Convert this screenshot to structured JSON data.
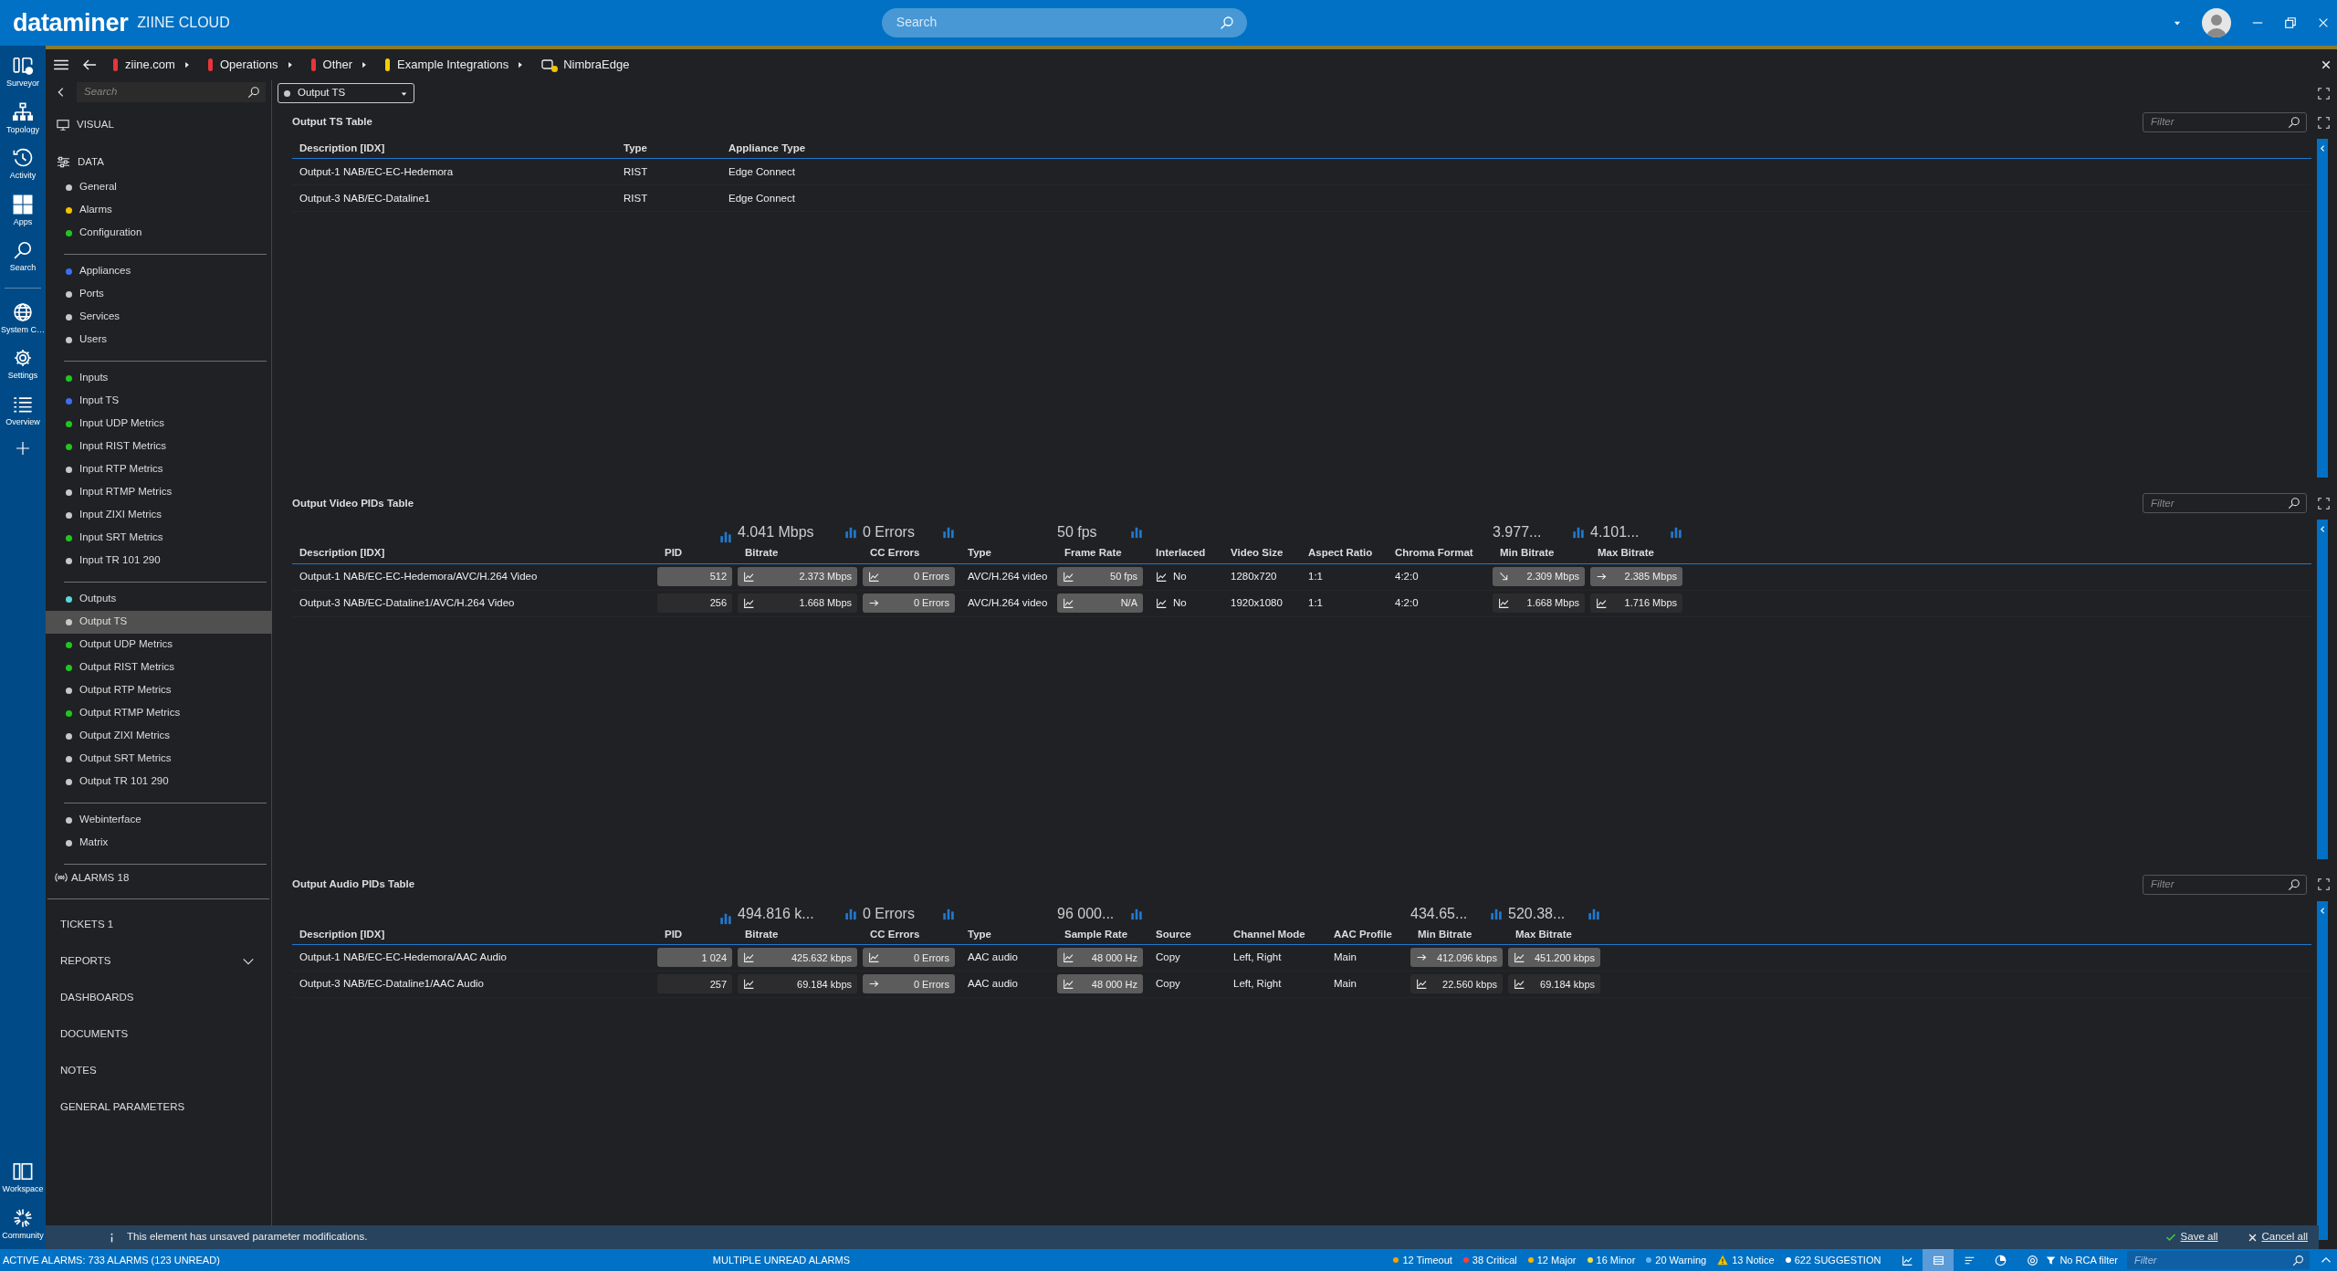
{
  "app": {
    "brand": "dataminer",
    "system": "ZIINE CLOUD",
    "search": {
      "placeholder": "Search"
    }
  },
  "rail": {
    "top": [
      "Surveyor",
      "Topology",
      "Activity",
      "Apps",
      "Search"
    ],
    "middle": [
      "System C…",
      "Settings",
      "Overview"
    ],
    "bottom": [
      "Workspace",
      "Community"
    ]
  },
  "breadcrumb": [
    {
      "label": "ziine.com",
      "kind": "view",
      "color": "#e8343c"
    },
    {
      "label": "Operations",
      "kind": "view",
      "color": "#e8343c"
    },
    {
      "label": "Other",
      "kind": "view",
      "color": "#e8343c"
    },
    {
      "label": "Example Integrations",
      "kind": "view",
      "color": "#f2d000"
    },
    {
      "label": "NimbraEdge",
      "kind": "element",
      "color": "#f2c200"
    }
  ],
  "sidebar": {
    "search": {
      "placeholder": "Search"
    },
    "visual": "VISUAL",
    "data": "DATA",
    "groups": [
      {
        "items": [
          {
            "label": "General",
            "color": "#c8c8c8",
            "selected": false
          },
          {
            "label": "Alarms",
            "color": "#f2c200",
            "selected": false
          },
          {
            "label": "Configuration",
            "color": "#1ec71e",
            "selected": false
          }
        ]
      },
      {
        "items": [
          {
            "label": "Appliances",
            "color": "#3a6ff0",
            "selected": false
          },
          {
            "label": "Ports",
            "color": "#c8c8c8",
            "selected": false
          },
          {
            "label": "Services",
            "color": "#c8c8c8",
            "selected": false
          },
          {
            "label": "Users",
            "color": "#c8c8c8",
            "selected": false
          }
        ]
      },
      {
        "items": [
          {
            "label": "Inputs",
            "color": "#1ec71e",
            "selected": false
          },
          {
            "label": "Input TS",
            "color": "#3a6ff0",
            "selected": false
          },
          {
            "label": "Input UDP Metrics",
            "color": "#1ec71e",
            "selected": false
          },
          {
            "label": "Input RIST Metrics",
            "color": "#1ec71e",
            "selected": false
          },
          {
            "label": "Input RTP Metrics",
            "color": "#c8c8c8",
            "selected": false
          },
          {
            "label": "Input RTMP Metrics",
            "color": "#c8c8c8",
            "selected": false
          },
          {
            "label": "Input ZIXI Metrics",
            "color": "#c8c8c8",
            "selected": false
          },
          {
            "label": "Input SRT Metrics",
            "color": "#1ec71e",
            "selected": false
          },
          {
            "label": "Input TR 101 290",
            "color": "#c8c8c8",
            "selected": false
          }
        ]
      },
      {
        "items": [
          {
            "label": "Outputs",
            "color": "#5cd6dc",
            "selected": false
          },
          {
            "label": "Output TS",
            "color": "#c8c8c8",
            "selected": true
          },
          {
            "label": "Output UDP Metrics",
            "color": "#1ec71e",
            "selected": false
          },
          {
            "label": "Output RIST Metrics",
            "color": "#1ec71e",
            "selected": false
          },
          {
            "label": "Output RTP Metrics",
            "color": "#c8c8c8",
            "selected": false
          },
          {
            "label": "Output RTMP Metrics",
            "color": "#1ec71e",
            "selected": false
          },
          {
            "label": "Output ZIXI Metrics",
            "color": "#c8c8c8",
            "selected": false
          },
          {
            "label": "Output SRT Metrics",
            "color": "#c8c8c8",
            "selected": false
          },
          {
            "label": "Output TR 101 290",
            "color": "#c8c8c8",
            "selected": false
          }
        ]
      },
      {
        "items": [
          {
            "label": "Webinterface",
            "color": "#c8c8c8",
            "selected": false
          },
          {
            "label": "Matrix",
            "color": "#c8c8c8",
            "selected": false
          }
        ]
      }
    ],
    "alarms": "ALARMS 18",
    "links": [
      {
        "label": "TICKETS 1",
        "has_submenu": false
      },
      {
        "label": "REPORTS",
        "has_submenu": true
      },
      {
        "label": "DASHBOARDS",
        "has_submenu": false
      },
      {
        "label": "DOCUMENTS",
        "has_submenu": false
      },
      {
        "label": "NOTES",
        "has_submenu": false
      },
      {
        "label": "GENERAL PARAMETERS",
        "has_submenu": false
      }
    ]
  },
  "page_selector": {
    "value": "Output TS",
    "color": "#c8c8c8"
  },
  "tables": [
    {
      "title": "Output TS Table",
      "filter": {
        "placeholder": "Filter"
      },
      "columns": [
        {
          "label": "Description [IDX]",
          "kind": "text"
        },
        {
          "label": "Type",
          "kind": "text"
        },
        {
          "label": "Appliance Type",
          "kind": "text"
        }
      ],
      "rows": [
        {
          "cells": [
            "Output-1 NAB/EC-EC-Hedemora",
            "RIST",
            "Edge Connect"
          ]
        },
        {
          "cells": [
            "Output-3 NAB/EC-Dataline1",
            "RIST",
            "Edge Connect"
          ]
        }
      ]
    },
    {
      "title": "Output Video PIDs Table",
      "filter": {
        "placeholder": "Filter"
      },
      "columns": [
        {
          "label": "Description [IDX]",
          "kind": "text"
        },
        {
          "label": "PID",
          "kind": "value",
          "stat": true
        },
        {
          "label": "Bitrate",
          "kind": "value",
          "aggregate": "4.041 Mbps",
          "stat": true
        },
        {
          "label": "CC Errors",
          "kind": "value",
          "aggregate": "0 Errors",
          "stat": true
        },
        {
          "label": "Type",
          "kind": "text"
        },
        {
          "label": "Frame Rate",
          "kind": "value",
          "aggregate": "50 fps",
          "stat": true
        },
        {
          "label": "Interlaced",
          "kind": "trend"
        },
        {
          "label": "Video Size",
          "kind": "text"
        },
        {
          "label": "Aspect Ratio",
          "kind": "text"
        },
        {
          "label": "Chroma Format",
          "kind": "text"
        },
        {
          "label": "Min Bitrate",
          "kind": "value",
          "aggregate": "3.977...",
          "stat": true
        },
        {
          "label": "Max Bitrate",
          "kind": "value",
          "aggregate": "4.101...",
          "stat": true
        }
      ],
      "rows": [
        {
          "cells": [
            "Output-1 NAB/EC-EC-Hedemora/AVC/H.264 Video",
            {
              "text": "512",
              "kind": "plain",
              "highlighted": true
            },
            {
              "text": "2.373 Mbps",
              "kind": "chart",
              "highlighted": true
            },
            {
              "text": "0 Errors",
              "kind": "chart",
              "highlighted": true
            },
            "AVC/H.264 video",
            {
              "text": "50 fps",
              "kind": "chart",
              "highlighted": true
            },
            {
              "text": "No",
              "kind": "chart"
            },
            "1280x720",
            "1:1",
            "4:2:0",
            {
              "text": "2.309 Mbps",
              "kind": "falling",
              "highlighted": true
            },
            {
              "text": "2.385 Mbps",
              "kind": "steady",
              "highlighted": true
            }
          ]
        },
        {
          "cells": [
            "Output-3 NAB/EC-Dataline1/AVC/H.264 Video",
            {
              "text": "256",
              "kind": "plain",
              "highlighted": false
            },
            {
              "text": "1.668 Mbps",
              "kind": "chart",
              "highlighted": false
            },
            {
              "text": "0 Errors",
              "kind": "steady",
              "highlighted": true
            },
            "AVC/H.264 video",
            {
              "text": "N/A",
              "kind": "chart",
              "highlighted": true
            },
            {
              "text": "No",
              "kind": "chart"
            },
            "1920x1080",
            "1:1",
            "4:2:0",
            {
              "text": "1.668 Mbps",
              "kind": "chart",
              "highlighted": false
            },
            {
              "text": "1.716 Mbps",
              "kind": "chart",
              "highlighted": false
            }
          ]
        }
      ]
    },
    {
      "title": "Output Audio PIDs Table",
      "filter": {
        "placeholder": "Filter"
      },
      "columns": [
        {
          "label": "Description [IDX]",
          "kind": "text"
        },
        {
          "label": "PID",
          "kind": "value",
          "stat": true
        },
        {
          "label": "Bitrate",
          "kind": "value",
          "aggregate": "494.816 k...",
          "stat": true
        },
        {
          "label": "CC Errors",
          "kind": "value",
          "aggregate": "0 Errors",
          "stat": true
        },
        {
          "label": "Type",
          "kind": "text"
        },
        {
          "label": "Sample Rate",
          "kind": "value",
          "aggregate": "96 000...",
          "stat": true
        },
        {
          "label": "Source",
          "kind": "text"
        },
        {
          "label": "Channel Mode",
          "kind": "text"
        },
        {
          "label": "AAC Profile",
          "kind": "text"
        },
        {
          "label": "Min Bitrate",
          "kind": "value",
          "aggregate": "434.65...",
          "stat": true
        },
        {
          "label": "Max Bitrate",
          "kind": "value",
          "aggregate": "520.38...",
          "stat": true
        }
      ],
      "rows": [
        {
          "cells": [
            "Output-1 NAB/EC-EC-Hedemora/AAC Audio",
            {
              "text": "1 024",
              "kind": "plain",
              "highlighted": true
            },
            {
              "text": "425.632 kbps",
              "kind": "chart",
              "highlighted": true
            },
            {
              "text": "0 Errors",
              "kind": "chart",
              "highlighted": true
            },
            "AAC audio",
            {
              "text": "48 000 Hz",
              "kind": "chart",
              "highlighted": true
            },
            "Copy",
            "Left, Right",
            "Main",
            {
              "text": "412.096 kbps",
              "kind": "steady",
              "highlighted": true
            },
            {
              "text": "451.200 kbps",
              "kind": "chart",
              "highlighted": true
            }
          ]
        },
        {
          "cells": [
            "Output-3 NAB/EC-Dataline1/AAC Audio",
            {
              "text": "257",
              "kind": "plain",
              "highlighted": false
            },
            {
              "text": "69.184 kbps",
              "kind": "chart",
              "highlighted": false
            },
            {
              "text": "0 Errors",
              "kind": "steady",
              "highlighted": true
            },
            "AAC audio",
            {
              "text": "48 000 Hz",
              "kind": "chart",
              "highlighted": true
            },
            "Copy",
            "Left, Right",
            "Main",
            {
              "text": "22.560 kbps",
              "kind": "chart",
              "highlighted": false
            },
            {
              "text": "69.184 kbps",
              "kind": "chart",
              "highlighted": false
            }
          ]
        }
      ]
    }
  ],
  "banner": {
    "message": "This element has unsaved parameter modifications.",
    "save": "Save all",
    "cancel": "Cancel all"
  },
  "status_bar": {
    "active": "ACTIVE ALARMS: 733 ALARMS (123 UNREAD)",
    "notice": "MULTIPLE UNREAD ALARMS",
    "counters": [
      {
        "label": "12 Timeout",
        "kind": "dot",
        "color": "#f5a000"
      },
      {
        "label": "38 Critical",
        "kind": "dot",
        "color": "#ff3b3b"
      },
      {
        "label": "12 Major",
        "kind": "dot",
        "color": "#ffb300"
      },
      {
        "label": "16 Minor",
        "kind": "dot",
        "color": "#f2e24a"
      },
      {
        "label": "20 Warning",
        "kind": "dot",
        "color": "#5fb7ff"
      },
      {
        "label": "13 Notice",
        "kind": "warning"
      },
      {
        "label": "622 SUGGESTION",
        "kind": "dot",
        "color": "#ffffff"
      }
    ],
    "view_buttons": [
      {
        "selected": false
      },
      {
        "selected": true
      },
      {
        "selected": false
      },
      {
        "selected": false
      }
    ],
    "rca_filter": "No RCA filter",
    "filter": {
      "placeholder": "Filter"
    }
  }
}
